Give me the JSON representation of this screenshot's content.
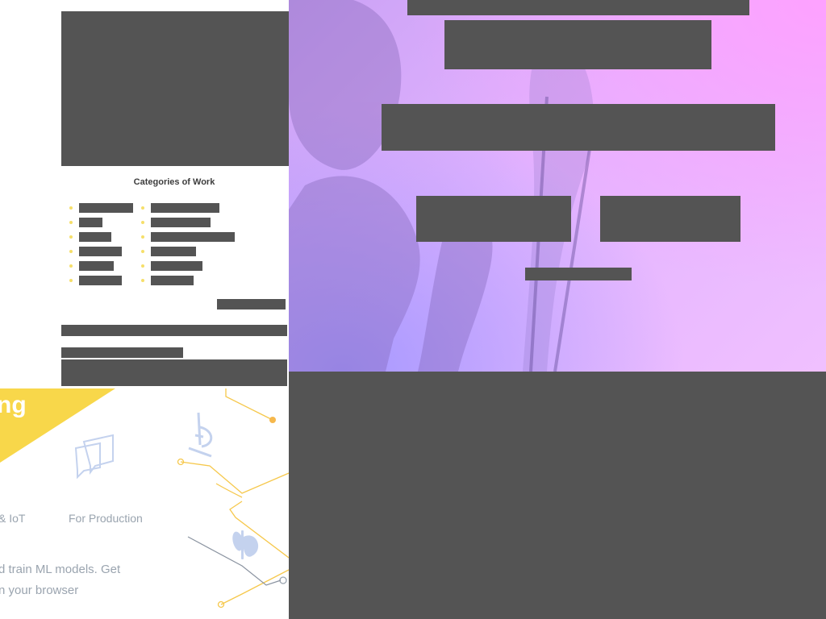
{
  "categories": {
    "title": "Categories of Work"
  },
  "promo": {
    "banner_text": "ng",
    "column_labels": [
      "& IoT",
      "For Production"
    ],
    "body_lines": [
      "d train ML models. Get",
      "n your browser"
    ],
    "colors": {
      "accent_yellow": "#f8d74a",
      "line_yellow": "#f6c84c",
      "icon_blue": "#c4d2ee",
      "text_gray": "#9aa4af"
    },
    "icons": [
      "chat-bubbles-icon",
      "microscope-icon",
      "butterfly-icon"
    ]
  },
  "colors": {
    "redaction": "#545454",
    "hero_gradient": [
      "#caa1f5",
      "#f0c0ff",
      "#a89cff"
    ]
  }
}
